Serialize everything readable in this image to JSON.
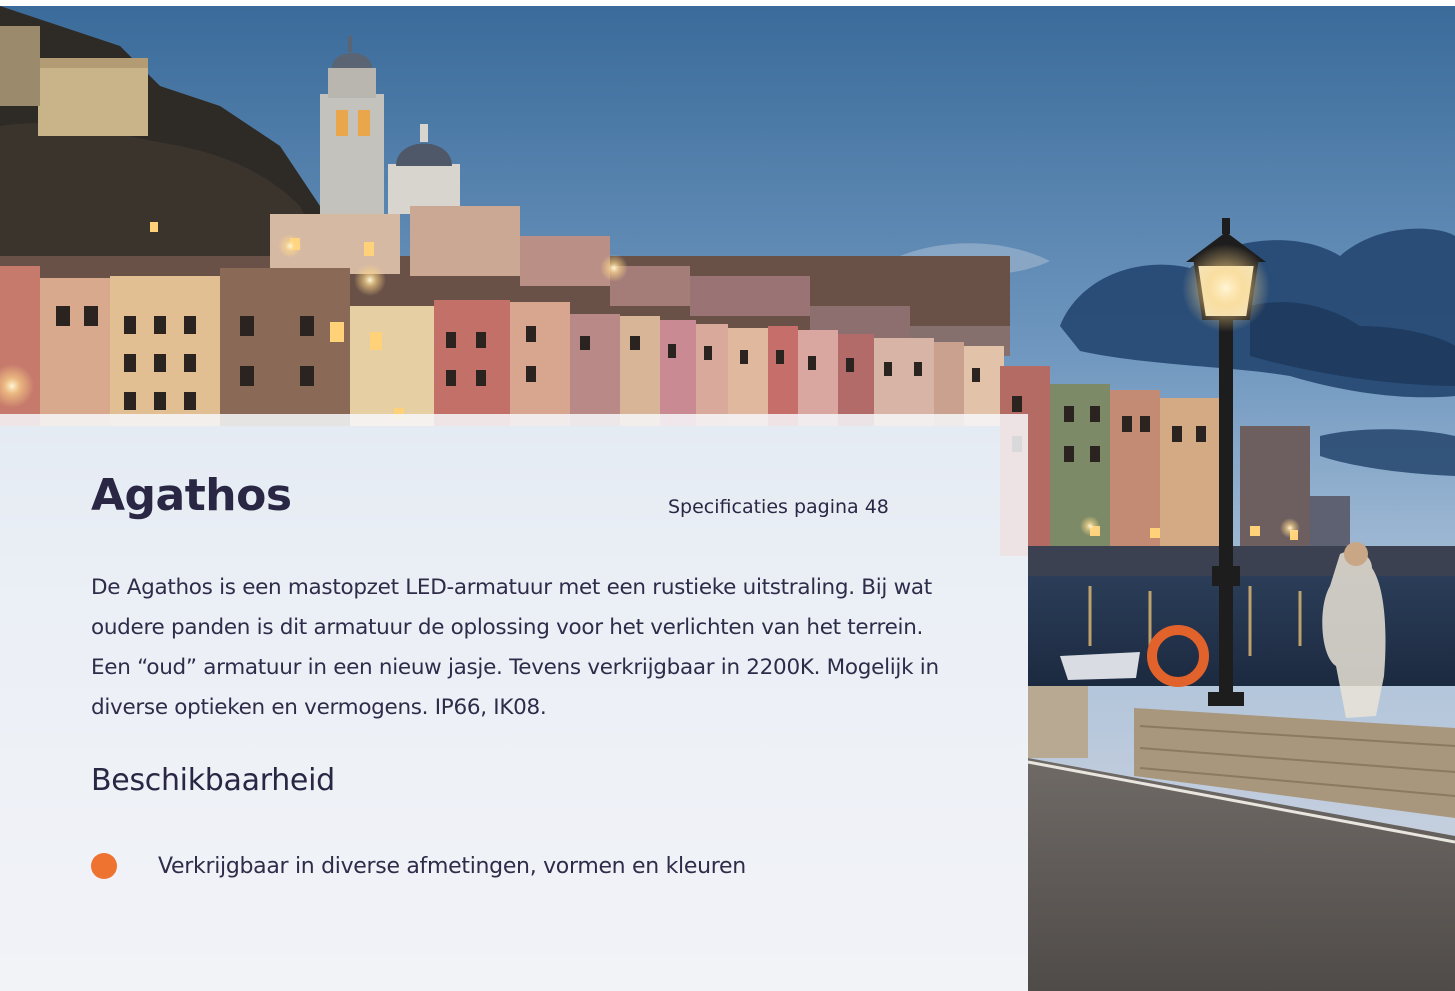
{
  "product": {
    "title": "Agathos",
    "spec_reference": "Specificaties pagina 48",
    "description": "De Agathos is een mastopzet LED-armatuur met een rustieke uitstraling. Bij wat oudere panden is dit armatuur de oplossing voor het verlichten van het terrein. Een “oud” armatuur in een nieuw jasje. Tevens verkrijgbaar in 2200K. Mogelijk in diverse optieken en vermogens. IP66, IK08."
  },
  "availability": {
    "heading": "Beschikbaarheid",
    "items": [
      "Verkrijgbaar in diverse afmetingen, vormen en kleuren"
    ]
  },
  "colors": {
    "text": "#2a2745",
    "accent": "#ee7330",
    "panel": "#f6f7fa"
  },
  "photo": {
    "subject": "harbour-town-dusk-photo",
    "icons": [
      "street-lamp-icon"
    ]
  }
}
